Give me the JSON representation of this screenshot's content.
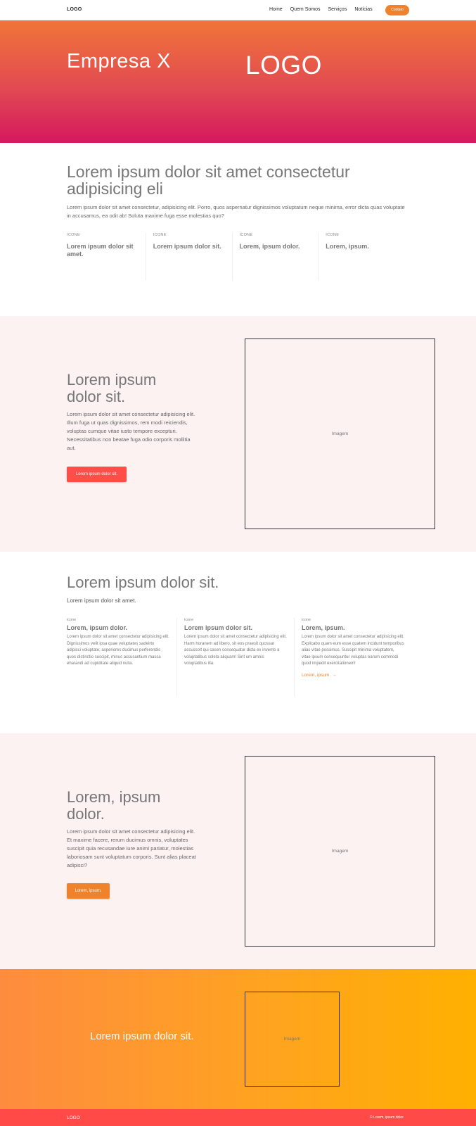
{
  "nav": {
    "logo": "LOGO",
    "items": [
      "Home",
      "Quem Somos",
      "Serviços",
      "Notícias"
    ],
    "cta": "Contato"
  },
  "hero": {
    "brand": "Empresa X",
    "logo": "LOGO",
    "gradient": [
      "#f07538",
      "#d5185f"
    ]
  },
  "intro": {
    "title": "Lorem ipsum dolor sit amet consectetur adipisicing eli",
    "text": "Lorem ipsum dolor sit amet consectetur, adipisicing elit. Porro, quos aspernatur dignissimos voluptatum neque minima, error dicta quas voluptate in accusamus, ea odit ab! Soluta maxime fuga esse molestias quo?",
    "features": [
      {
        "icon": "ICONE",
        "title": "Lorem ipsum dolor sit amet."
      },
      {
        "icon": "ICONE",
        "title": "Lorem ipsum dolor sit."
      },
      {
        "icon": "ICONE",
        "title": "Lorem, ipsum dolor."
      },
      {
        "icon": "ICONE",
        "title": "Lorem, ipsum."
      }
    ]
  },
  "split1": {
    "title": "Lorem ipsum dolor sit.",
    "text": "Lorem ipsum dolor sit amet consectetur adipisicing elit. Illum fuga ut quas dignissimos, rem modi reiciendis, voluptas cumque vitae iusto tempore excepturi. Necessitatibus non beatae fuga odio corporis mollitia aut.",
    "button": "Lorem ipsum dolor sit.",
    "button_color": "#ff4d4a",
    "image_label": "Imagem"
  },
  "services": {
    "title": "Lorem ipsum dolor sit.",
    "subtitle": "Lorem ipsum dolor sit amet.",
    "columns": [
      {
        "icon": "icone",
        "title": "Lorem, ipsum dolor.",
        "text": "Lorem ipsum dolor sit amet consectetur adipisicing elit. Dignissimos velit ipsa quae voluptates sadeirto adipisci voluptate, asperiores ducimus perferendis quos distinctio suscipit, minus accusantium massa eharandi ad cupiditate aliquid nulla."
      },
      {
        "icon": "icone",
        "title": "Lorem ipsum dolor sit.",
        "text": "Lorem ipsum dolor sit amet consectetur adipisicing elit. Harm horanem ad libero, sit eos praesit quossat accussolt qui casen consequatur dicta ex invento a voluptatibus soleta aliquam! Sint um amnis voluptatibus illa."
      },
      {
        "icon": "icone",
        "title": "Lorem, ipsum.",
        "text": "Lorem ipsum dolor sit amet consectetur adipisicing elit. Explicabo quam eum esse quatem incidunt temporibus alias vitae possimus. Suscipit minima voluptatem, vitae ipsum consequuntur voluptas earum commodi quod impedit exercitationem!",
        "link": "Lorem, ipsum. →"
      }
    ]
  },
  "split2": {
    "title": "Lorem, ipsum dolor.",
    "text": "Lorem ipsum dolor sit amet consectetur adipisicing elit. Et maxime facere, rerum ducimus omnis, voluptates suscipit quia recusandae iure animi pariatur, molestias laboriosam sunt voluptatum corporis. Sunt alias placeat adipisci?",
    "button": "Lorem, ipsum.",
    "button_color": "#f0822c",
    "image_label": "Imagem"
  },
  "band": {
    "title": "Lorem ipsum dolor sit.",
    "image_label": "Imagem",
    "gradient": [
      "#fe8c3f",
      "#ffb000"
    ]
  },
  "footer": {
    "logo": "LOGO",
    "copyright": "© Lorem, ipsum dolor."
  }
}
